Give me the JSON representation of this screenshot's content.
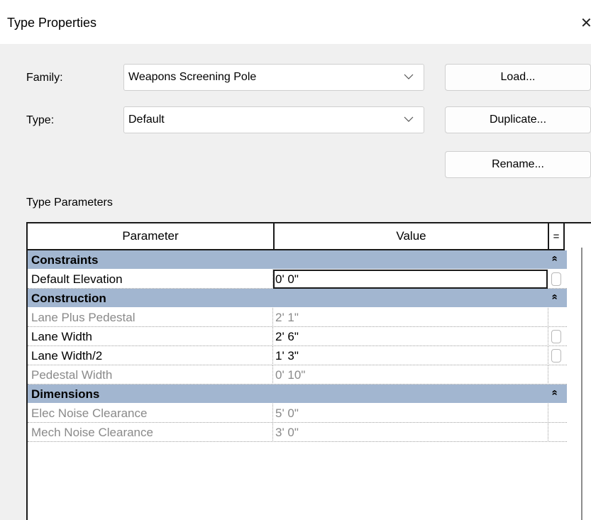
{
  "window": {
    "title": "Type Properties",
    "close_glyph": "✕"
  },
  "family": {
    "label": "Family:",
    "value": "Weapons Screening Pole"
  },
  "type": {
    "label": "Type:",
    "value": "Default"
  },
  "buttons": {
    "load": "Load...",
    "duplicate": "Duplicate...",
    "rename": "Rename..."
  },
  "type_parameters": {
    "heading": "Type Parameters",
    "columns": {
      "parameter": "Parameter",
      "value": "Value",
      "assoc": "="
    },
    "groups": [
      {
        "name": "Constraints",
        "collapse_glyph": "»",
        "rows": [
          {
            "name": "Default Elevation",
            "value": "0'  0\""
          }
        ]
      },
      {
        "name": "Construction",
        "collapse_glyph": "»",
        "rows": [
          {
            "name": "Lane Plus Pedestal",
            "value": "2'  1\""
          },
          {
            "name": "Lane Width",
            "value": "2'  6\""
          },
          {
            "name": "Lane Width/2",
            "value": "1'  3\""
          },
          {
            "name": "Pedestal Width",
            "value": "0'  10\""
          }
        ]
      },
      {
        "name": "Dimensions",
        "collapse_glyph": "»",
        "rows": [
          {
            "name": "Elec Noise Clearance",
            "value": "5'  0\""
          },
          {
            "name": "Mech Noise Clearance",
            "value": "3'  0\""
          }
        ]
      }
    ]
  },
  "colors": {
    "group_header_bg": "#a2b6d0",
    "readonly_text": "#8a8a8a",
    "dialog_bg": "#f0f0f0"
  }
}
